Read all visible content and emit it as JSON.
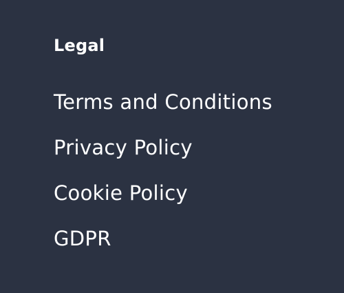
{
  "footer": {
    "heading": "Legal",
    "links": [
      {
        "label": "Terms and Conditions"
      },
      {
        "label": "Privacy Policy"
      },
      {
        "label": "Cookie Policy"
      },
      {
        "label": "GDPR"
      }
    ]
  },
  "colors": {
    "background": "#2b3242",
    "text": "#ffffff"
  }
}
